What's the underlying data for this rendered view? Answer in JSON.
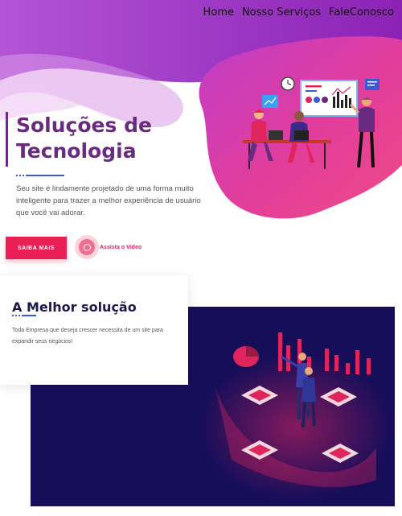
{
  "nav": {
    "items": [
      "Home",
      "Nosso Serviços",
      "FaleConosco"
    ]
  },
  "hero": {
    "title_line1": "Soluções de",
    "title_line2": "Tecnologia",
    "description": "Seu site é lindamente projetado de uma forma muito inteligente para trazer a melhor experiência de usuário que você vai adorar.",
    "primary_button": "SAIBA MAIS",
    "video_link": "Assista o Vídeo"
  },
  "solution": {
    "title": "A Melhor solução",
    "description": "Toda Empresa que deseja crescer necessita de um site para expandir seus negócios!"
  },
  "colors": {
    "accent_pink": "#ea1f55",
    "purple": "#6a2a80",
    "dark_navy": "#170e5a",
    "dot_blue": "#3b5bd6"
  }
}
